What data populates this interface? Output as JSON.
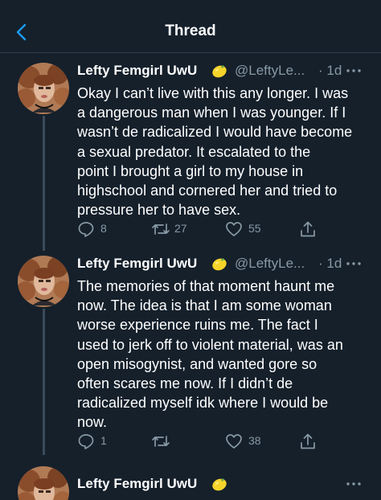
{
  "header": {
    "title": "Thread",
    "back_icon": "chevron-left-icon"
  },
  "colors": {
    "background": "#15202b",
    "accent": "#1d9bf0",
    "secondary_text": "#8899a6",
    "divider": "#2f3c4a"
  },
  "tweets": [
    {
      "display_name": "Lefty Femgirl UwU",
      "emoji": "lemon",
      "handle": "@LeftyLe...",
      "time": "· 1d",
      "more_label": "···",
      "lines": [
        "Okay I can’t live with this any longer.  I was",
        "a dangerous man when I was younger.  If I",
        "wasn’t de radicalized I would have become",
        "a sexual predator.   It escalated to the",
        "point I brought a girl to my house in",
        "highschool and cornered her and tried to",
        "pressure her to have sex."
      ],
      "replies": "8",
      "retweets": "27",
      "likes": "55"
    },
    {
      "display_name": "Lefty Femgirl UwU",
      "emoji": "lemon",
      "handle": "@LeftyLe...",
      "time": "· 1d",
      "more_label": "···",
      "lines": [
        "The memories of that moment haunt me",
        "now.  The idea is that I am some woman",
        "worse experience ruins me.  The fact I",
        "used to jerk off to violent material, was an",
        "open misogynist, and wanted gore so",
        "often scares me now.  If I didn’t de",
        "radicalized myself idk where I would be",
        "now."
      ],
      "replies": "1",
      "retweets": "",
      "likes": "38"
    },
    {
      "display_name": "Lefty Femgirl UwU",
      "emoji": "lemon",
      "more_label": "···"
    }
  ]
}
